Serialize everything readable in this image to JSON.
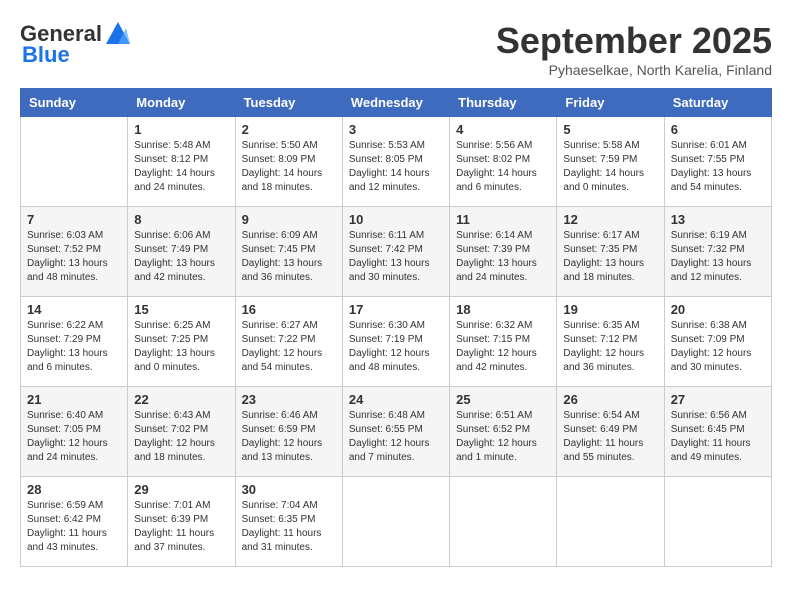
{
  "header": {
    "logo_general": "General",
    "logo_blue": "Blue",
    "title": "September 2025",
    "subtitle": "Pyhaeselkae, North Karelia, Finland"
  },
  "calendar": {
    "days_of_week": [
      "Sunday",
      "Monday",
      "Tuesday",
      "Wednesday",
      "Thursday",
      "Friday",
      "Saturday"
    ],
    "weeks": [
      [
        {
          "day": "",
          "info": ""
        },
        {
          "day": "1",
          "info": "Sunrise: 5:48 AM\nSunset: 8:12 PM\nDaylight: 14 hours\nand 24 minutes."
        },
        {
          "day": "2",
          "info": "Sunrise: 5:50 AM\nSunset: 8:09 PM\nDaylight: 14 hours\nand 18 minutes."
        },
        {
          "day": "3",
          "info": "Sunrise: 5:53 AM\nSunset: 8:05 PM\nDaylight: 14 hours\nand 12 minutes."
        },
        {
          "day": "4",
          "info": "Sunrise: 5:56 AM\nSunset: 8:02 PM\nDaylight: 14 hours\nand 6 minutes."
        },
        {
          "day": "5",
          "info": "Sunrise: 5:58 AM\nSunset: 7:59 PM\nDaylight: 14 hours\nand 0 minutes."
        },
        {
          "day": "6",
          "info": "Sunrise: 6:01 AM\nSunset: 7:55 PM\nDaylight: 13 hours\nand 54 minutes."
        }
      ],
      [
        {
          "day": "7",
          "info": "Sunrise: 6:03 AM\nSunset: 7:52 PM\nDaylight: 13 hours\nand 48 minutes."
        },
        {
          "day": "8",
          "info": "Sunrise: 6:06 AM\nSunset: 7:49 PM\nDaylight: 13 hours\nand 42 minutes."
        },
        {
          "day": "9",
          "info": "Sunrise: 6:09 AM\nSunset: 7:45 PM\nDaylight: 13 hours\nand 36 minutes."
        },
        {
          "day": "10",
          "info": "Sunrise: 6:11 AM\nSunset: 7:42 PM\nDaylight: 13 hours\nand 30 minutes."
        },
        {
          "day": "11",
          "info": "Sunrise: 6:14 AM\nSunset: 7:39 PM\nDaylight: 13 hours\nand 24 minutes."
        },
        {
          "day": "12",
          "info": "Sunrise: 6:17 AM\nSunset: 7:35 PM\nDaylight: 13 hours\nand 18 minutes."
        },
        {
          "day": "13",
          "info": "Sunrise: 6:19 AM\nSunset: 7:32 PM\nDaylight: 13 hours\nand 12 minutes."
        }
      ],
      [
        {
          "day": "14",
          "info": "Sunrise: 6:22 AM\nSunset: 7:29 PM\nDaylight: 13 hours\nand 6 minutes."
        },
        {
          "day": "15",
          "info": "Sunrise: 6:25 AM\nSunset: 7:25 PM\nDaylight: 13 hours\nand 0 minutes."
        },
        {
          "day": "16",
          "info": "Sunrise: 6:27 AM\nSunset: 7:22 PM\nDaylight: 12 hours\nand 54 minutes."
        },
        {
          "day": "17",
          "info": "Sunrise: 6:30 AM\nSunset: 7:19 PM\nDaylight: 12 hours\nand 48 minutes."
        },
        {
          "day": "18",
          "info": "Sunrise: 6:32 AM\nSunset: 7:15 PM\nDaylight: 12 hours\nand 42 minutes."
        },
        {
          "day": "19",
          "info": "Sunrise: 6:35 AM\nSunset: 7:12 PM\nDaylight: 12 hours\nand 36 minutes."
        },
        {
          "day": "20",
          "info": "Sunrise: 6:38 AM\nSunset: 7:09 PM\nDaylight: 12 hours\nand 30 minutes."
        }
      ],
      [
        {
          "day": "21",
          "info": "Sunrise: 6:40 AM\nSunset: 7:05 PM\nDaylight: 12 hours\nand 24 minutes."
        },
        {
          "day": "22",
          "info": "Sunrise: 6:43 AM\nSunset: 7:02 PM\nDaylight: 12 hours\nand 18 minutes."
        },
        {
          "day": "23",
          "info": "Sunrise: 6:46 AM\nSunset: 6:59 PM\nDaylight: 12 hours\nand 13 minutes."
        },
        {
          "day": "24",
          "info": "Sunrise: 6:48 AM\nSunset: 6:55 PM\nDaylight: 12 hours\nand 7 minutes."
        },
        {
          "day": "25",
          "info": "Sunrise: 6:51 AM\nSunset: 6:52 PM\nDaylight: 12 hours\nand 1 minute."
        },
        {
          "day": "26",
          "info": "Sunrise: 6:54 AM\nSunset: 6:49 PM\nDaylight: 11 hours\nand 55 minutes."
        },
        {
          "day": "27",
          "info": "Sunrise: 6:56 AM\nSunset: 6:45 PM\nDaylight: 11 hours\nand 49 minutes."
        }
      ],
      [
        {
          "day": "28",
          "info": "Sunrise: 6:59 AM\nSunset: 6:42 PM\nDaylight: 11 hours\nand 43 minutes."
        },
        {
          "day": "29",
          "info": "Sunrise: 7:01 AM\nSunset: 6:39 PM\nDaylight: 11 hours\nand 37 minutes."
        },
        {
          "day": "30",
          "info": "Sunrise: 7:04 AM\nSunset: 6:35 PM\nDaylight: 11 hours\nand 31 minutes."
        },
        {
          "day": "",
          "info": ""
        },
        {
          "day": "",
          "info": ""
        },
        {
          "day": "",
          "info": ""
        },
        {
          "day": "",
          "info": ""
        }
      ]
    ]
  }
}
